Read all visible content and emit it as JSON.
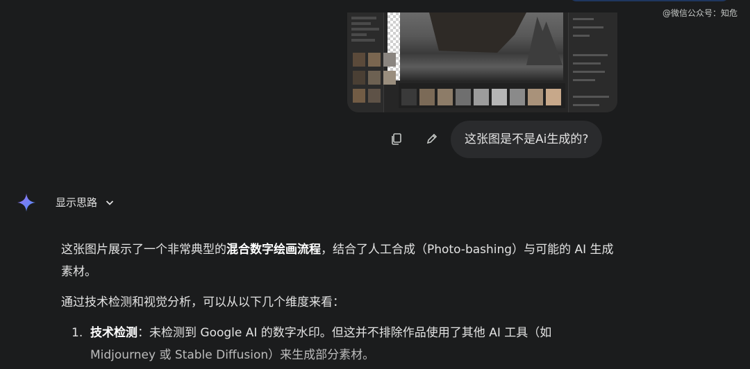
{
  "watermark": "@微信公众号：知危",
  "user_message": {
    "text": "这张图是不是Ai生成的?"
  },
  "actions": {
    "copy_icon": "copy-icon",
    "edit_icon": "pencil-icon"
  },
  "response": {
    "show_thinking_label": "显示思路",
    "p1": {
      "part1": "这张图片展示了一个非常典型的",
      "bold": "混合数字绘画流程",
      "part2": "，结合了人工合成（Photo-bashing）与可能的 AI 生成素材。"
    },
    "p2": "通过技术检测和视觉分析，可以从以下几个维度来看：",
    "list": [
      {
        "number": "1.",
        "bold": "技术检测",
        "text1": "：未检测到 Google AI 的数字水印。但这并不排除作品使用了其他 AI 工具（如",
        "text2": "Midjourney 或 Stable Diffusion）来生成部分素材。"
      }
    ]
  },
  "colors": {
    "background": "#1b1c1d",
    "bubble": "#2a2b2d",
    "accent": "#4c8df6"
  }
}
